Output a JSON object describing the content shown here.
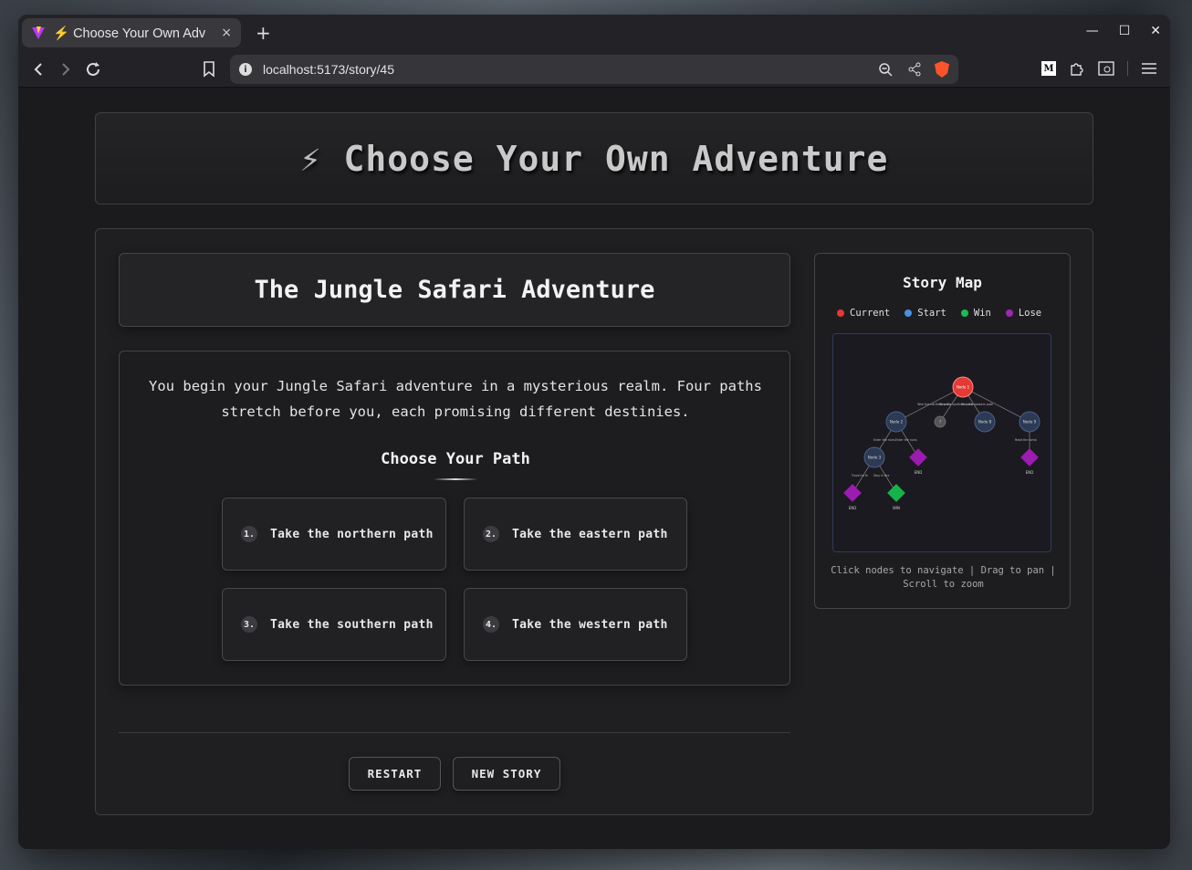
{
  "browser": {
    "tab_title": "⚡ Choose Your Own Adv",
    "tab_close": "×",
    "new_tab": "+",
    "url": "localhost:5173/story/45",
    "win_min": "—",
    "win_max": "☐",
    "win_close": "✕",
    "medium_label": "M"
  },
  "app": {
    "bolt": "⚡",
    "title": "Choose Your Own Adventure"
  },
  "story": {
    "title": "The Jungle Safari Adventure",
    "narrative": "You begin your Jungle Safari adventure in a mysterious realm. Four paths stretch before you, each promising different destinies.",
    "choose_heading": "Choose Your Path",
    "choices": [
      {
        "num": "1.",
        "label": "Take the northern path"
      },
      {
        "num": "2.",
        "label": "Take the eastern path"
      },
      {
        "num": "3.",
        "label": "Take the southern path"
      },
      {
        "num": "4.",
        "label": "Take the western path"
      }
    ],
    "restart_label": "RESTART",
    "new_story_label": "NEW STORY"
  },
  "map": {
    "title": "Story Map",
    "legend": [
      {
        "label": "Current",
        "color": "#e53935"
      },
      {
        "label": "Start",
        "color": "#4a8fe0"
      },
      {
        "label": "Win",
        "color": "#1db954"
      },
      {
        "label": "Lose",
        "color": "#9c27b0"
      }
    ],
    "nodes": {
      "node1": "Node 1",
      "node2": "Node 2",
      "node3": "Node 3",
      "node8": "Node 8",
      "node9": "Node 9",
      "unknown": "?",
      "end": "END",
      "win": "WIN"
    },
    "edges": {
      "e1": "Take the northern path",
      "e2": "Take the southern path",
      "e3": "Take the western path",
      "e4": "Enter the ruins",
      "e5": "Enter the ruins",
      "e6": "Read the tomb",
      "e7": "Travel to th",
      "e8": "Stay in the"
    },
    "hint": "Click nodes to navigate | Drag to pan | Scroll to zoom"
  }
}
